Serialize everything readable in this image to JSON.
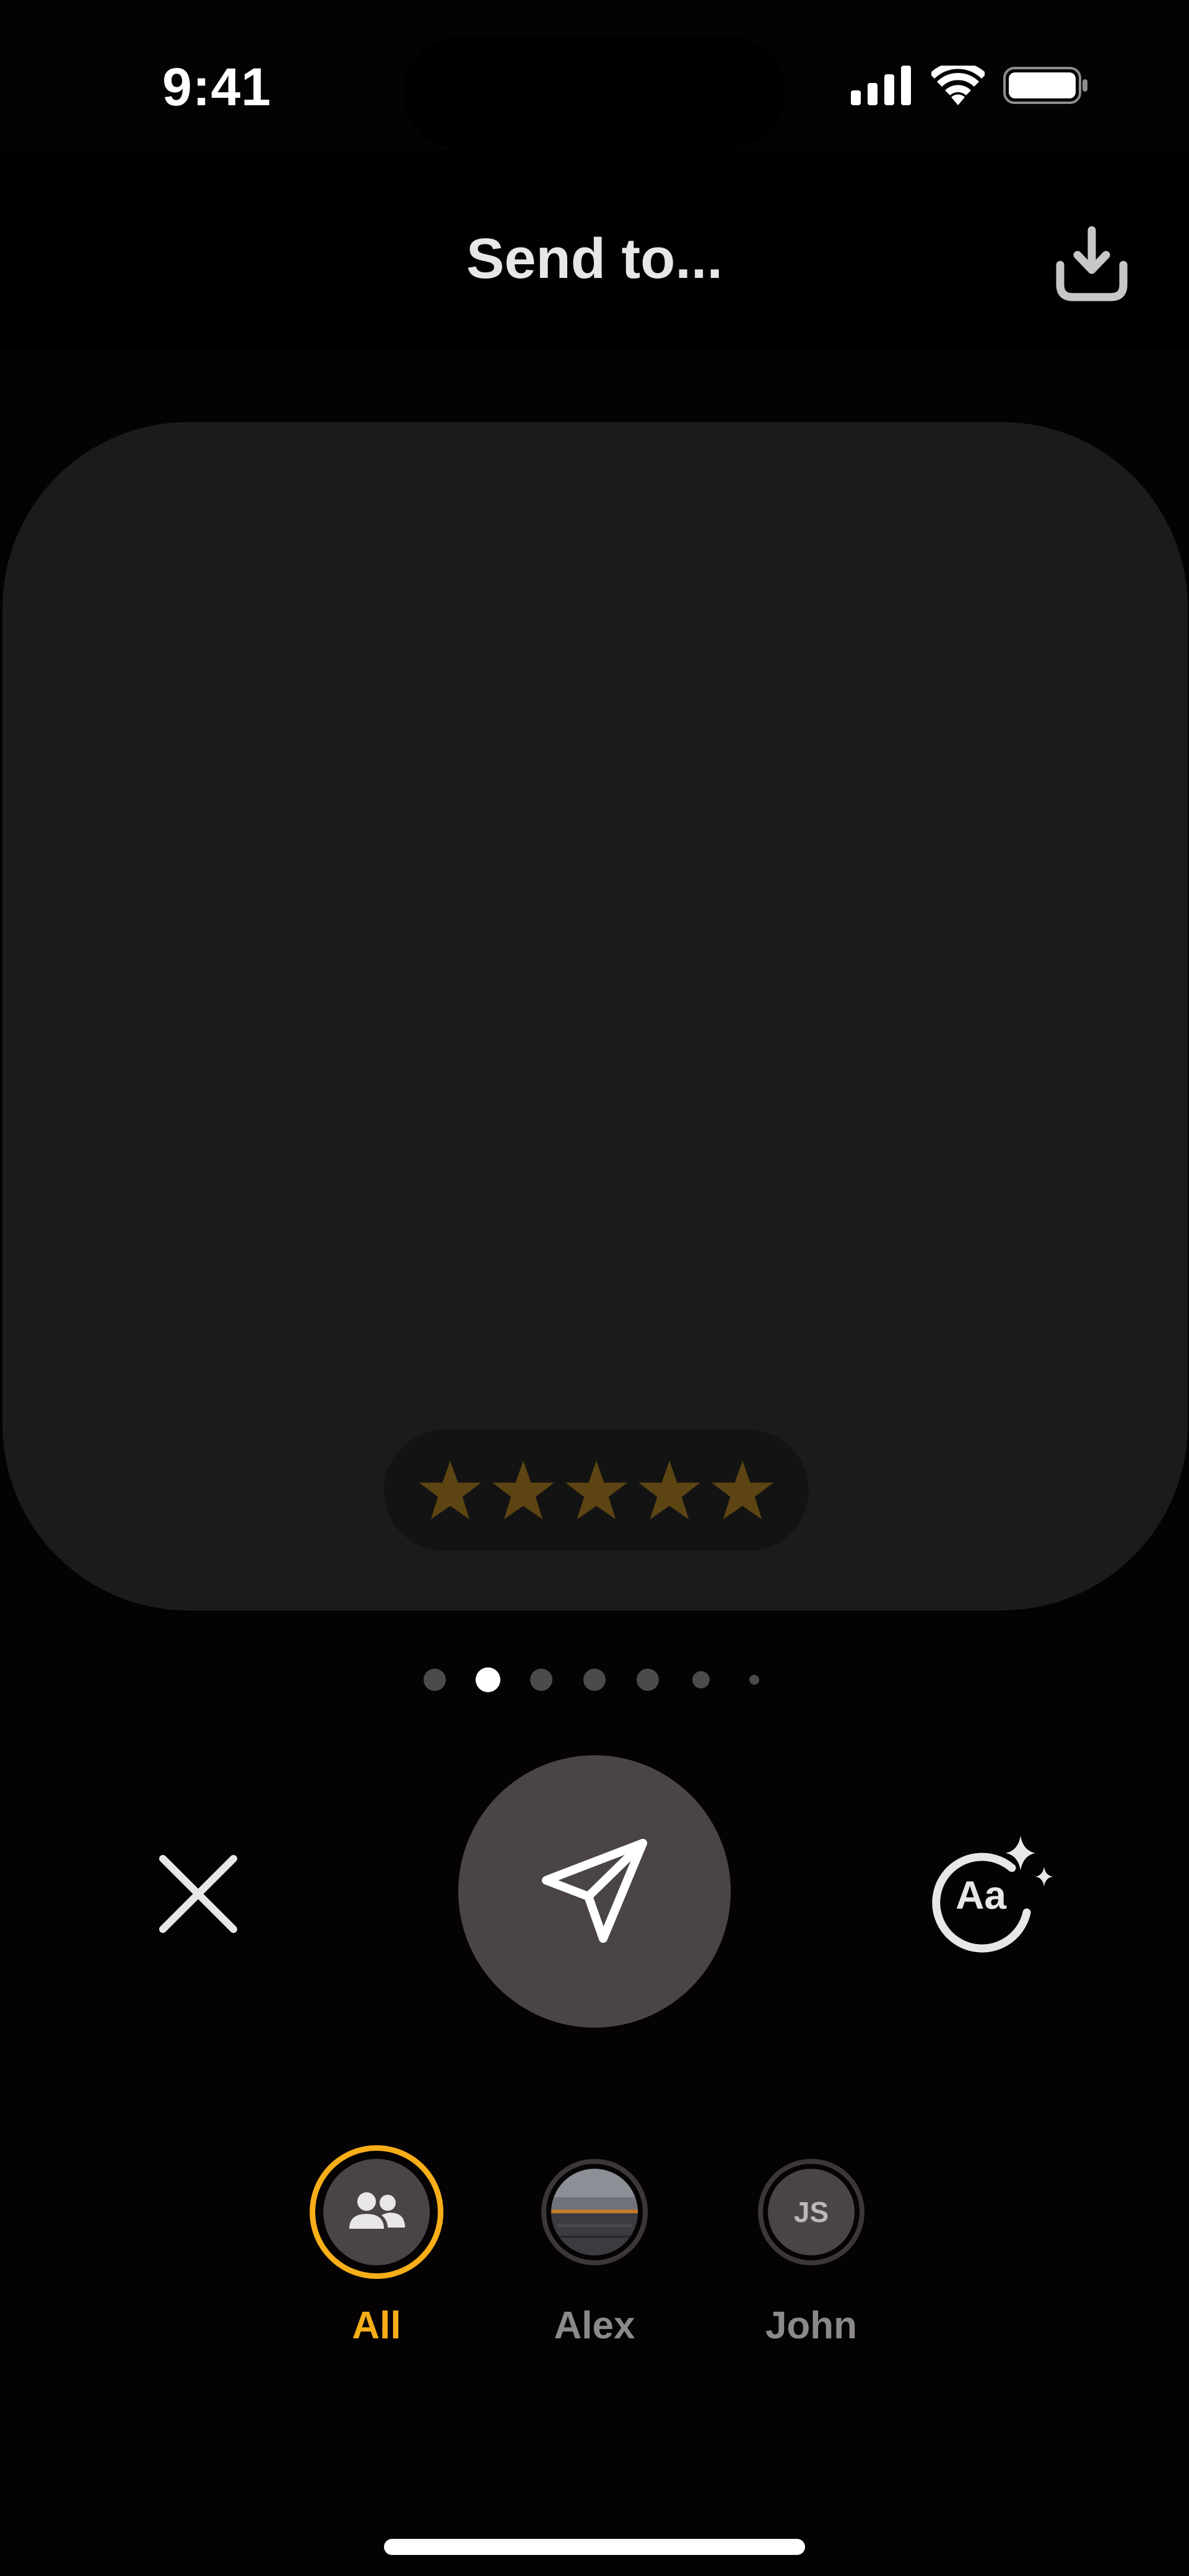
{
  "status_bar": {
    "time": "9:41",
    "icons": [
      "cellular-signal-icon",
      "wifi-icon",
      "battery-icon"
    ]
  },
  "header": {
    "title": "Send to...",
    "download_icon": "download-icon"
  },
  "preview": {
    "rating": 5,
    "rating_max": 5,
    "star_color": "#5c4513"
  },
  "pagination": {
    "count": 7,
    "active_index": 1
  },
  "actions": {
    "close_icon": "close-icon",
    "send_icon": "send-icon",
    "text_style_icon": "text-style-sparkle-icon",
    "text_style_label": "Aa"
  },
  "recipients": [
    {
      "label": "All",
      "selected": true,
      "avatar": "group-icon"
    },
    {
      "label": "Alex",
      "selected": false,
      "avatar": "photo"
    },
    {
      "label": "John",
      "selected": false,
      "avatar": "initials",
      "initials": "JS"
    }
  ],
  "colors": {
    "accent": "#f7ae18",
    "background": "#050203",
    "card": "#1c1b1c",
    "button": "#4a4445"
  }
}
